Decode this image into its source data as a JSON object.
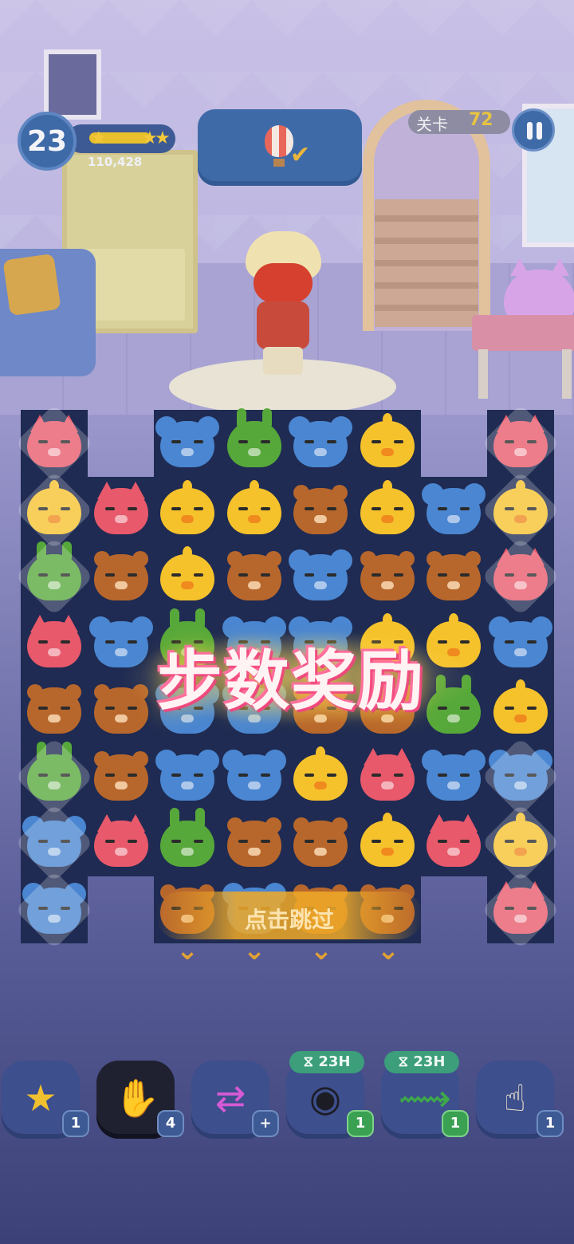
{
  "hud": {
    "player_level": "23",
    "score": "110,428",
    "xp_progress": 0.8,
    "stage_label": "关卡",
    "stage_number": "72"
  },
  "goal": {
    "icon": "hot-air-balloon-icon",
    "status_icon": "checkmark-icon"
  },
  "overlay": {
    "banner_text": "步数奖励",
    "skip_text": "点击跳过"
  },
  "board": {
    "tile_colors": {
      "fox": "#e8596b",
      "chick": "#f5c22c",
      "bear": "#b8672c",
      "mouse": "#4a86d1",
      "rabbit": "#57a83a"
    },
    "rows": [
      [
        "fox",
        null,
        "mouse",
        "rabbit",
        "mouse",
        "chick",
        null,
        "fox"
      ],
      [
        "chick",
        "fox",
        "chick",
        "chick",
        "bear",
        "chick",
        "mouse",
        "chick"
      ],
      [
        "rabbit",
        "bear",
        "chick",
        "bear",
        "mouse",
        "bear",
        "bear",
        "fox"
      ],
      [
        "fox",
        "mouse",
        "rabbit",
        "mouse",
        "mouse",
        "chick",
        "chick",
        "mouse"
      ],
      [
        "bear",
        "bear",
        "mouse",
        "mouse",
        "bear",
        "bear",
        "rabbit",
        "chick"
      ],
      [
        "rabbit",
        "bear",
        "mouse",
        "mouse",
        "chick",
        "fox",
        "mouse",
        "mouse"
      ],
      [
        "mouse",
        "fox",
        "rabbit",
        "bear",
        "bear",
        "chick",
        "fox",
        "chick"
      ],
      [
        "mouse",
        null,
        "bear",
        "mouse",
        "bear",
        "bear",
        null,
        "fox"
      ]
    ]
  },
  "boosters": [
    {
      "name": "star-wand",
      "icon": "★",
      "count": "1",
      "timer": null
    },
    {
      "name": "glove-x3",
      "icon": "✋",
      "count": "4",
      "timer": null
    },
    {
      "name": "swap",
      "icon": "⇄",
      "count": "+",
      "timer": null
    },
    {
      "name": "goggles",
      "icon": "◉",
      "count": "1",
      "timer": "23H"
    },
    {
      "name": "roller",
      "icon": "⟿",
      "count": "1",
      "timer": "23H"
    },
    {
      "name": "hand-tap",
      "icon": "☝",
      "count": "1",
      "timer": null
    }
  ]
}
